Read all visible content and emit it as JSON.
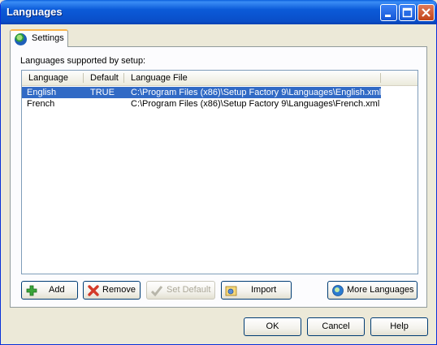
{
  "window": {
    "title": "Languages"
  },
  "tab": {
    "label": "Settings"
  },
  "section_label": "Languages supported by setup:",
  "table": {
    "columns": [
      "Language",
      "Default",
      "Language File"
    ],
    "rows": [
      {
        "language": "English",
        "default": "TRUE",
        "file": "C:\\Program Files (x86)\\Setup Factory 9\\Languages\\English.xml",
        "selected": true
      },
      {
        "language": "French",
        "default": "",
        "file": "C:\\Program Files (x86)\\Setup Factory 9\\Languages\\French.xml",
        "selected": false
      }
    ]
  },
  "buttons": {
    "add": "Add",
    "remove": "Remove",
    "set_default": "Set Default",
    "import": "Import",
    "more_languages": "More Languages",
    "ok": "OK",
    "cancel": "Cancel",
    "help": "Help"
  },
  "colors": {
    "titlebar": "#0a5fdc",
    "selection": "#316ac5",
    "tab_accent": "#f9b54c"
  }
}
